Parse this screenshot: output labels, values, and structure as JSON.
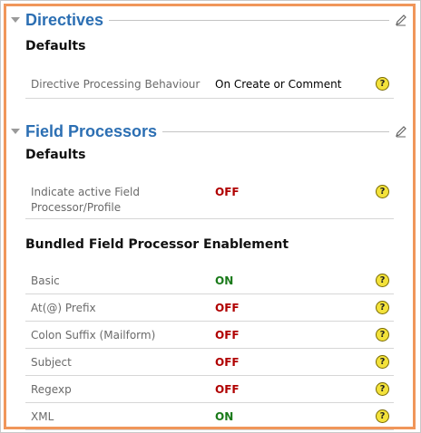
{
  "directives": {
    "title": "Directives",
    "defaults_heading": "Defaults",
    "rows": [
      {
        "label": "Directive Processing Behaviour",
        "value": "On Create or Comment",
        "value_style": "plain"
      }
    ]
  },
  "field_processors": {
    "title": "Field Processors",
    "defaults_heading": "Defaults",
    "defaults_rows": [
      {
        "label": "Indicate active Field Processor/Profile",
        "value": "OFF",
        "value_style": "off"
      }
    ],
    "bundled_heading": "Bundled Field Processor Enablement",
    "bundled_rows": [
      {
        "label": "Basic",
        "value": "ON",
        "value_style": "on"
      },
      {
        "label": "At(@) Prefix",
        "value": "OFF",
        "value_style": "off"
      },
      {
        "label": "Colon Suffix (Mailform)",
        "value": "OFF",
        "value_style": "off"
      },
      {
        "label": "Subject",
        "value": "OFF",
        "value_style": "off"
      },
      {
        "label": "Regexp",
        "value": "OFF",
        "value_style": "off"
      },
      {
        "label": "XML",
        "value": "ON",
        "value_style": "on"
      }
    ]
  },
  "help_glyph": "?",
  "colors": {
    "title": "#2c6fb3",
    "off": "#b00000",
    "on": "#1a7a1a",
    "accent_border": "#f0965a",
    "help_bg": "#f3e23b"
  },
  "icons": {
    "collapse": "triangle-down-icon",
    "edit": "pencil-icon",
    "help": "help-icon"
  }
}
